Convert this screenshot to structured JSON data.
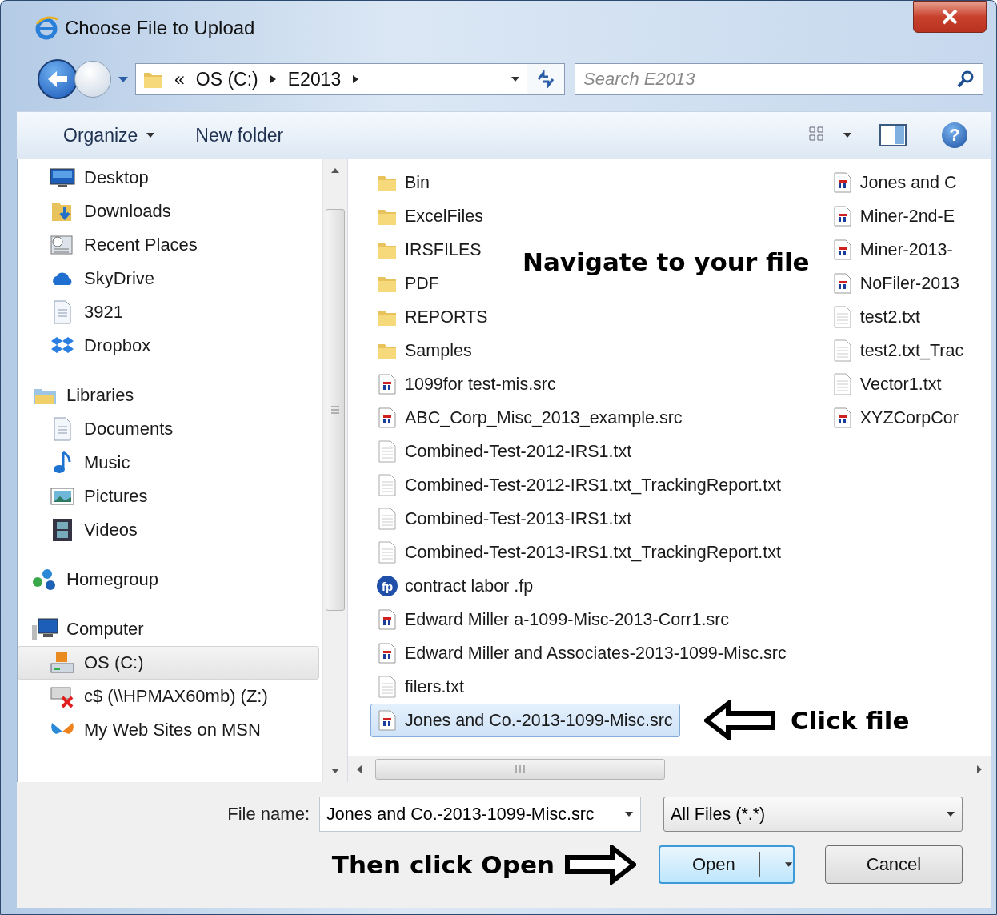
{
  "window": {
    "title": "Choose File to Upload"
  },
  "address_bar": {
    "overflow": "«",
    "crumbs": [
      "OS (C:)",
      "E2013"
    ]
  },
  "search": {
    "placeholder": "Search E2013"
  },
  "toolbar": {
    "buttons": [
      {
        "label": "Organize",
        "kind": "menu"
      },
      {
        "label": "New folder",
        "kind": "plain"
      }
    ],
    "help": "?"
  },
  "sidebar": {
    "favorites": [
      {
        "label": "Desktop",
        "kind": "desktop",
        "selected": false
      },
      {
        "label": "Downloads",
        "kind": "downloads",
        "selected": false
      },
      {
        "label": "Recent Places",
        "kind": "recent",
        "selected": false
      },
      {
        "label": "SkyDrive",
        "kind": "cloud",
        "selected": false
      },
      {
        "label": "3921",
        "kind": "document",
        "selected": false
      },
      {
        "label": "Dropbox",
        "kind": "box",
        "selected": false
      }
    ],
    "groups": [
      {
        "label": "Libraries",
        "kind": "libraries",
        "selected": false,
        "children": [
          {
            "label": "Documents",
            "kind": "document",
            "selected": false
          },
          {
            "label": "Music",
            "kind": "music",
            "selected": false
          },
          {
            "label": "Pictures",
            "kind": "pictures",
            "selected": false
          },
          {
            "label": "Videos",
            "kind": "videos",
            "selected": false
          }
        ]
      },
      {
        "label": "Homegroup",
        "kind": "homegroup",
        "selected": false
      },
      {
        "label": "Computer",
        "kind": "computer",
        "selected": false,
        "children": [
          {
            "label": "OS (C:)",
            "kind": "drive",
            "selected": true
          },
          {
            "label": "c$ (\\\\HPMAX60mb) (Z:)",
            "kind": "netdrive",
            "selected": false
          },
          {
            "label": "My Web Sites on MSN",
            "kind": "butterfly",
            "selected": false
          }
        ]
      }
    ]
  },
  "files": {
    "hint": "Navigate to your file",
    "click_hint": "Click file",
    "columns": [
      [
        {
          "name": "Bin",
          "kind": "folder",
          "selected": false
        },
        {
          "name": "ExcelFiles",
          "kind": "folder",
          "selected": false
        },
        {
          "name": "IRSFILES",
          "kind": "folder",
          "selected": false
        },
        {
          "name": "PDF",
          "kind": "folder",
          "selected": false
        },
        {
          "name": "REPORTS",
          "kind": "folder",
          "selected": false
        },
        {
          "name": "Samples",
          "kind": "folder",
          "selected": false
        },
        {
          "name": "1099for test-mis.src",
          "kind": "src",
          "selected": false
        },
        {
          "name": "ABC_Corp_Misc_2013_example.src",
          "kind": "src",
          "selected": false
        },
        {
          "name": "Combined-Test-2012-IRS1.txt",
          "kind": "txt",
          "selected": false
        },
        {
          "name": "Combined-Test-2012-IRS1.txt_TrackingReport.txt",
          "kind": "txt",
          "selected": false
        },
        {
          "name": "Combined-Test-2013-IRS1.txt",
          "kind": "txt",
          "selected": false
        },
        {
          "name": "Combined-Test-2013-IRS1.txt_TrackingReport.txt",
          "kind": "txt",
          "selected": false
        },
        {
          "name": "contract labor .fp",
          "kind": "fp",
          "badge": "fp",
          "selected": false
        },
        {
          "name": "Edward Miller a-1099-Misc-2013-Corr1.src",
          "kind": "src",
          "selected": false
        },
        {
          "name": "Edward Miller and Associates-2013-1099-Misc.src",
          "kind": "src",
          "selected": false
        },
        {
          "name": "filers.txt",
          "kind": "txt",
          "selected": false
        },
        {
          "name": "Jones and Co.-2013-1099-Misc.src",
          "kind": "src",
          "selected": true
        }
      ],
      [
        {
          "name": "Jones and C",
          "kind": "src",
          "selected": false
        },
        {
          "name": "Miner-2nd-E",
          "kind": "src",
          "selected": false
        },
        {
          "name": "Miner-2013-",
          "kind": "src",
          "selected": false
        },
        {
          "name": "NoFiler-2013",
          "kind": "src",
          "selected": false
        },
        {
          "name": "test2.txt",
          "kind": "txt",
          "selected": false
        },
        {
          "name": "test2.txt_Trac",
          "kind": "txt",
          "selected": false
        },
        {
          "name": "Vector1.txt",
          "kind": "txt",
          "selected": false
        },
        {
          "name": "XYZCorpCor",
          "kind": "src",
          "selected": false
        }
      ]
    ]
  },
  "footer": {
    "file_name": {
      "label": "File name:",
      "value": "Jones and Co.-2013-1099-Misc.src"
    },
    "file_type": {
      "value": "All Files (*.*)"
    },
    "open_hint": "Then click Open",
    "buttons": [
      {
        "label": "Open",
        "kind": "split"
      },
      {
        "label": "Cancel",
        "kind": "plain"
      }
    ]
  }
}
